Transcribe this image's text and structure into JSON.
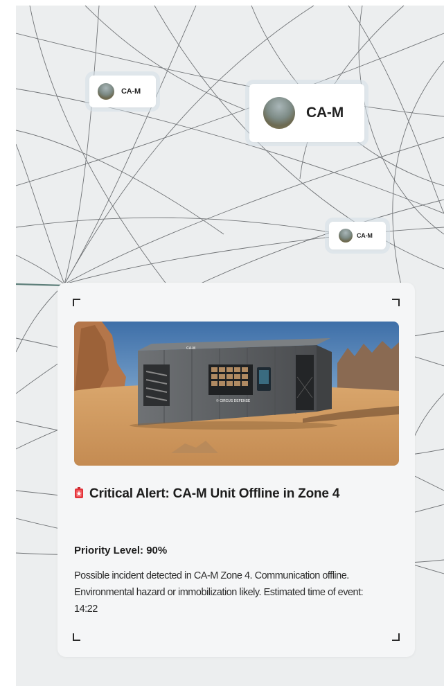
{
  "map": {
    "markers": [
      {
        "label": "CA-M",
        "icon": "unit-thumbnail-icon"
      },
      {
        "label": "CA-M",
        "icon": "unit-thumbnail-icon"
      },
      {
        "label": "CA-M",
        "icon": "unit-thumbnail-icon"
      }
    ]
  },
  "alert_card": {
    "title": "Critical Alert: CA-M Unit Offline in Zone 4",
    "icon": "siren-icon",
    "priority": "Priority Level: 90%",
    "priority_value": 0.9,
    "description": "Possible incident detected in CA-M Zone 4. Communication offline. Environmental hazard or immobilization likely. Estimated time of event: 14:22",
    "photo": {
      "container_brand": "CA-M",
      "container_side_text": "© CIRCUS DEFENSE"
    }
  },
  "colors": {
    "background": "#eceeef",
    "card": "#f5f6f7",
    "alert_red": "#e2333a",
    "accent_teal": "#5e7f7a"
  }
}
